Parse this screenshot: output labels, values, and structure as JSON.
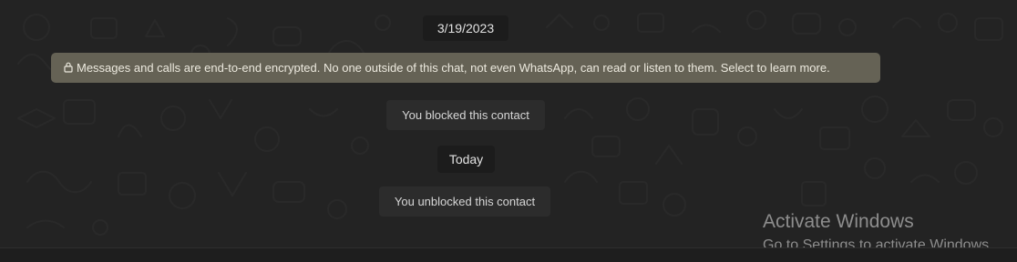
{
  "chat": {
    "messages": [
      {
        "type": "date",
        "text": "3/19/2023"
      },
      {
        "type": "encryption",
        "text": "Messages and calls are end-to-end encrypted. No one outside of this chat, not even WhatsApp, can read or listen to them. Select to learn more.",
        "icon": "lock-icon"
      },
      {
        "type": "system",
        "text": "You blocked this contact"
      },
      {
        "type": "date",
        "text": "Today"
      },
      {
        "type": "system",
        "text": "You unblocked this contact"
      }
    ]
  },
  "watermark": {
    "title": "Activate Windows",
    "subtitle": "Go to Settings to activate Windows"
  },
  "colors": {
    "background": "#232323",
    "encryption_banner": "#656255",
    "date_pill": "#1c1c1c",
    "system_pill": "#2c2c2c"
  }
}
